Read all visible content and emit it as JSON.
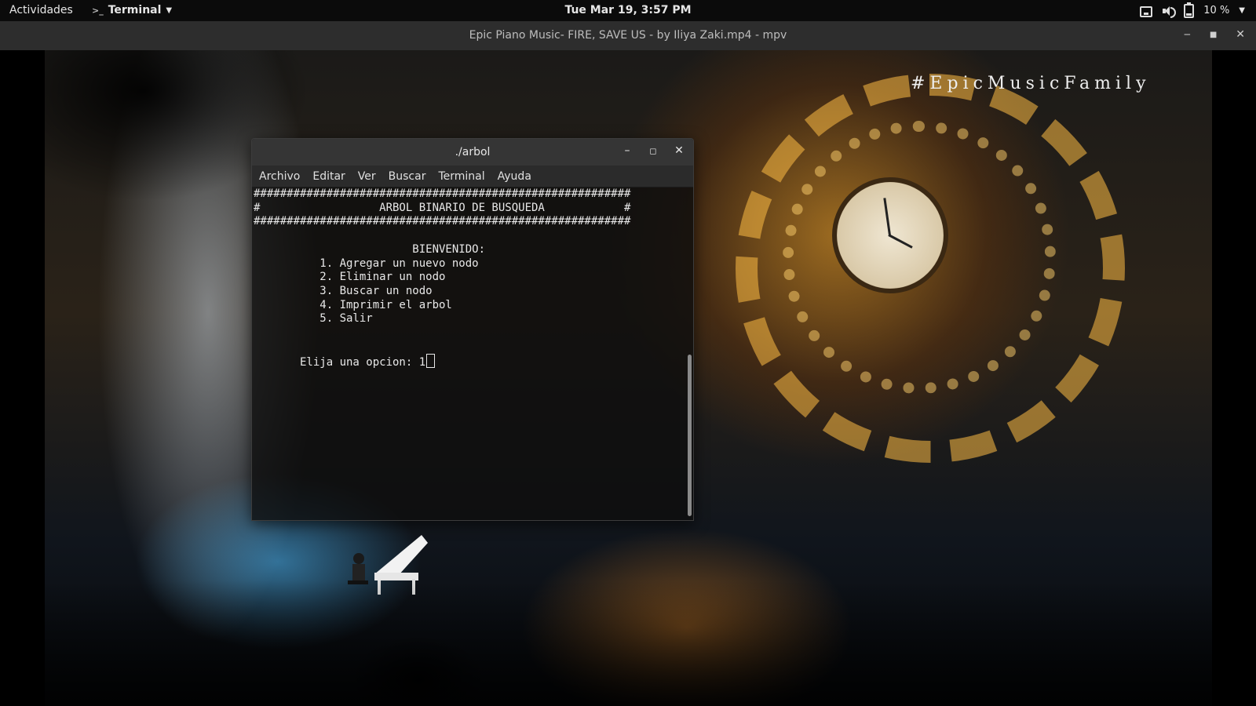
{
  "topbar": {
    "activities": "Actividades",
    "app_name": "Terminal",
    "clock": "Tue Mar 19,  3:57 PM",
    "battery": "10 %"
  },
  "player": {
    "window_title": "Epic Piano Music- FIRE, SAVE US - by Iliya Zaki.mp4 - mpv",
    "overlay_text": "#EpicMusicFamily"
  },
  "terminal": {
    "title": "./arbol",
    "menu": [
      "Archivo",
      "Editar",
      "Ver",
      "Buscar",
      "Terminal",
      "Ayuda"
    ],
    "lines": [
      "#########################################################",
      "#                  ARBOL BINARIO DE BUSQUEDA            #",
      "#########################################################",
      "",
      "                        BIENVENIDO:",
      "          1. Agregar un nuevo nodo",
      "          2. Eliminar un nodo",
      "          3. Buscar un nodo",
      "          4. Imprimir el arbol",
      "          5. Salir",
      "",
      ""
    ],
    "prompt": "       Elija una opcion: ",
    "input_value": "1"
  }
}
